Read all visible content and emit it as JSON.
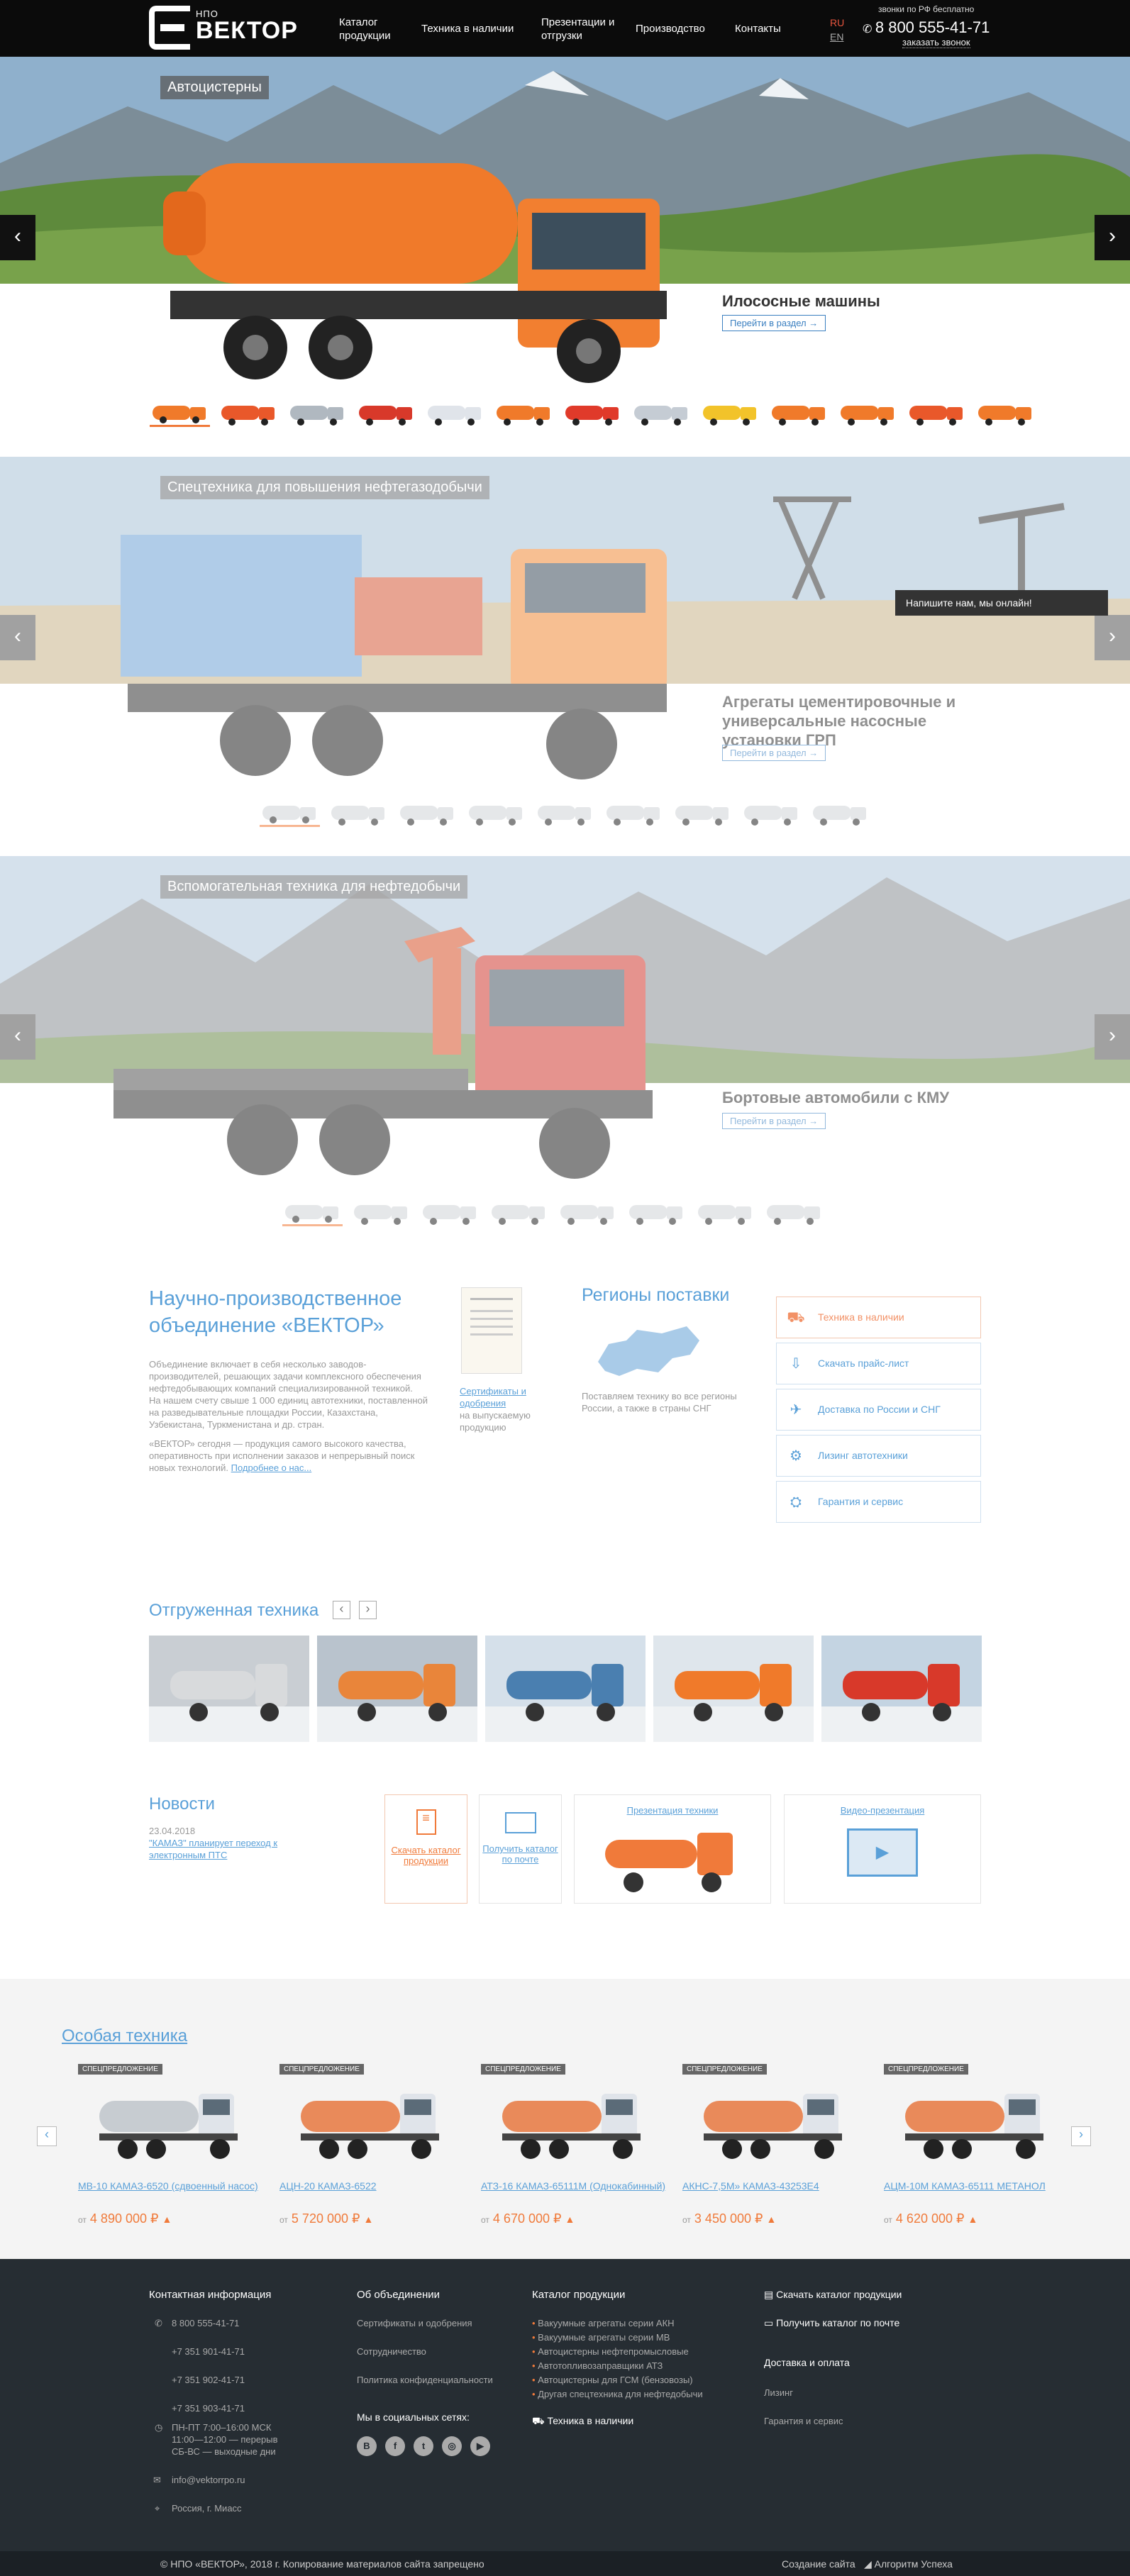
{
  "header": {
    "logo_small": "НПО",
    "logo_big": "ВЕКТОР",
    "nav": [
      "Каталог продукции",
      "Техника в наличии",
      "Презентации и отгрузки",
      "Производство",
      "Контакты"
    ],
    "lang_ru": "RU",
    "lang_en": "EN",
    "phone_note": "звонки по РФ бесплатно",
    "phone": "8 800 555-41-71",
    "callback": "заказать звонок"
  },
  "sliders": [
    {
      "tag": "Автоцистерны",
      "title": "Илососные машины",
      "link": "Перейти в раздел →"
    },
    {
      "tag": "Спецтехника для повышения нефтегазодобычи",
      "title": "Агрегаты цементировочные и универсальные насосные установки ГРП",
      "link": "Перейти в раздел →"
    },
    {
      "tag": "Вспомогательная техника для нефтедобычи",
      "title": "Бортовые автомобили с КМУ",
      "link": "Перейти в раздел →"
    }
  ],
  "chat": "Напишите нам, мы онлайн!",
  "about": {
    "title": "Научно-производственное объединение «ВЕКТОР»",
    "p1": "Объединение включает в себя несколько заводов-производителей, решающих задачи комплексного обеспечения нефтедобывающих компаний специализированной техникой.",
    "p2": "На нашем счету свыше 1 000 единиц автотехники, поставленной на разведывательные площадки России, Казахстана, Узбекистана, Туркменистана и др. стран.",
    "p3": "«ВЕКТОР» сегодня — продукция самого высокого качества, оперативность при исполнении заказов и непрерывный поиск новых технологий.",
    "more": "Подробнее о нас..."
  },
  "certs": {
    "link": "Сертификаты и одобрения",
    "text": "на выпускаемую продукцию"
  },
  "regions": {
    "title": "Регионы поставки",
    "text": "Поставляем технику во все регионы России, а также в страны СНГ"
  },
  "services": [
    "Техника в наличии",
    "Скачать прайс-лист",
    "Доставка по России и СНГ",
    "Лизинг автотехники",
    "Гарантия и сервис"
  ],
  "shipped": {
    "title": "Отгруженная техника",
    "prev": "‹",
    "next": "›"
  },
  "news": {
    "title": "Новости",
    "date": "23.04.2018",
    "text": "\"КАМАЗ\" планирует переход к электронным ПТС"
  },
  "downloads": {
    "catalog": "Скачать каталог продукции",
    "receive": "Получить каталог по почте",
    "pres": "Презентация техники",
    "video": "Видео-презентация"
  },
  "special": {
    "title": "Особая техника",
    "badge": "СПЕЦПРЕДЛОЖЕНИЕ",
    "from": "от",
    "currency": "₽",
    "items": [
      {
        "name": "МВ-10 КАМАЗ-6520 (сдвоенный насос)",
        "price": "4 890 000",
        "color": "#c7ccd1"
      },
      {
        "name": "АЦН-20 КАМАЗ-6522",
        "price": "5 720 000",
        "color": "#e98a5a"
      },
      {
        "name": "АТЗ-16 КАМАЗ-65111М (Однокабинный)",
        "price": "4 670 000",
        "color": "#e98a5a"
      },
      {
        "name": "АКНС-7,5М» КАМАЗ-43253Е4",
        "price": "3 450 000",
        "color": "#e98a5a"
      },
      {
        "name": "АЦМ-10М КАМАЗ-65111 МЕТАНОЛ",
        "price": "4 620 000",
        "color": "#e98a5a"
      }
    ],
    "prev": "‹",
    "next": "›"
  },
  "footer": {
    "contact_title": "Контактная информация",
    "phones": [
      "8 800 555-41-71",
      "+7 351 901-41-71",
      "+7 351 902-41-71",
      "+7 351 903-41-71"
    ],
    "hours": [
      "ПН-ПТ 7:00–16:00 МСК",
      "11:00—12:00 — перерыв",
      "СБ-ВС — выходные дни"
    ],
    "email": "info@vektorrpo.ru",
    "address": "Россия, г. Миасс",
    "about_title": "Об объединении",
    "about_links": [
      "Сертификаты и одобрения",
      "Сотрудничество",
      "Политика конфиденциальности"
    ],
    "social_title": "Мы в социальных сетях:",
    "social": [
      "В",
      "f",
      "t",
      "◎",
      "▶"
    ],
    "catalog_title": "Каталог продукции",
    "catalog_links": [
      "Вакуумные агрегаты серии АКН",
      "Вакуумные агрегаты серии МВ",
      "Автоцистерны нефтепромысловые",
      "Автотопливозаправщики АТЗ",
      "Автоцистерны для ГСМ (бензовозы)",
      "Другая спецтехника для нефтедобычи"
    ],
    "stock": "Техника в наличии",
    "dl_catalog": "Скачать каталог продукции",
    "mail_catalog": "Получить каталог по почте",
    "delivery_title": "Доставка и оплата",
    "delivery_links": [
      "Лизинг",
      "Гарантия и сервис"
    ]
  },
  "copyright": {
    "left": "© НПО «ВЕКТОР», 2018 г. Копирование материалов сайта запрещено",
    "right": "Создание сайта",
    "brand": "Алгоритм Успеха"
  }
}
